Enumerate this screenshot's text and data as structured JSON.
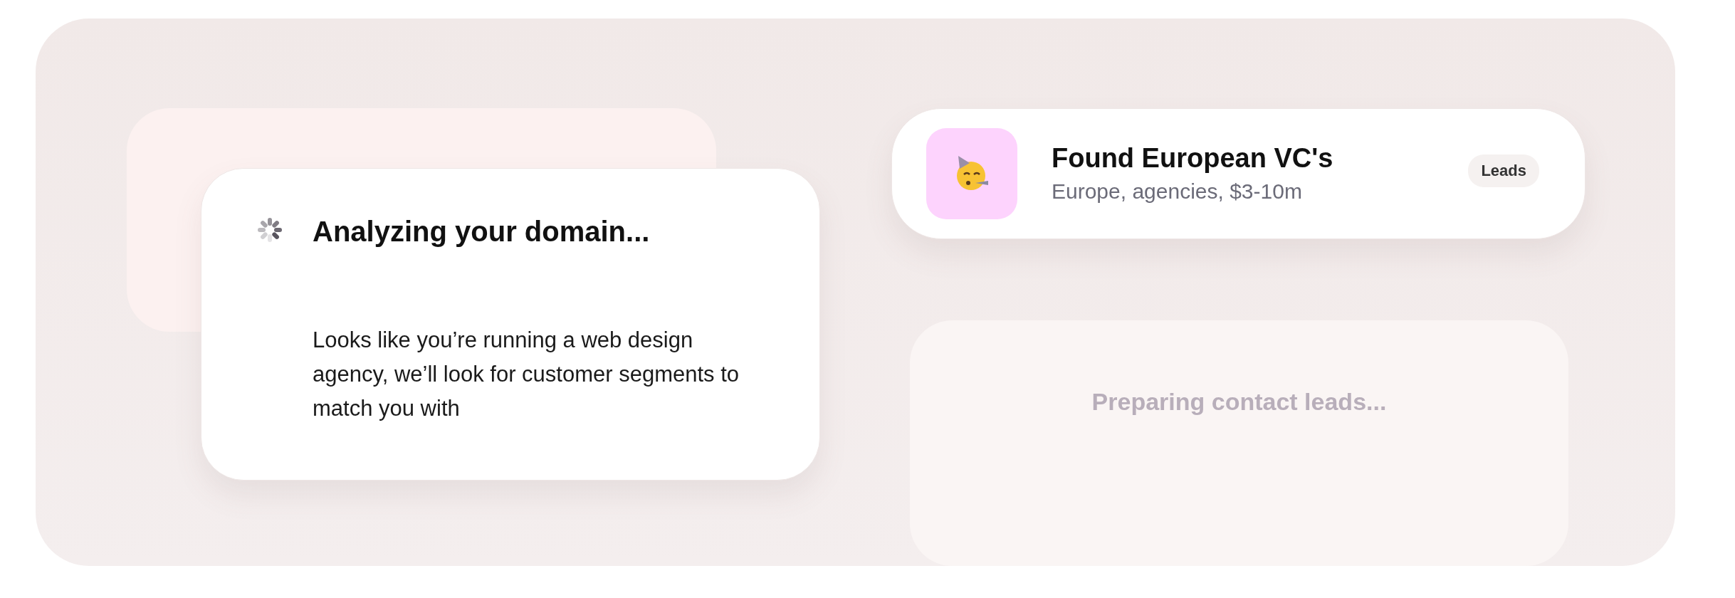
{
  "analysis_card": {
    "title": "Analyzing your domain...",
    "message": "Looks like you’re running a web design agency, we’ll look for customer segments to match you with"
  },
  "result_card": {
    "title": "Found European VC's",
    "subtitle": "Europe, agencies, $3-10m",
    "badge": "Leads"
  },
  "pending_card": {
    "message": "Preparing contact leads..."
  }
}
